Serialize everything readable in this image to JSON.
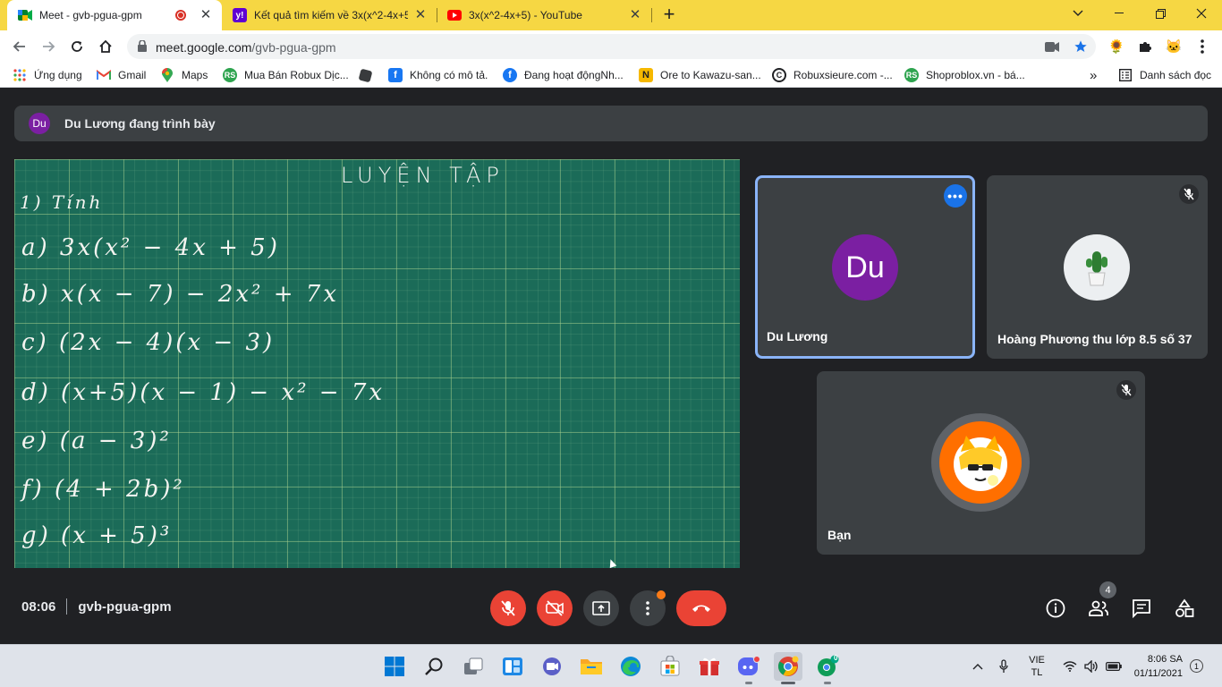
{
  "browser": {
    "tabs": [
      {
        "title": "Meet - gvb-pgua-gpm",
        "active": true
      },
      {
        "title": "Kết quả tìm kiếm về 3x(x^2-4x+5",
        "active": false
      },
      {
        "title": "3x(x^2-4x+5) - YouTube",
        "active": false
      }
    ],
    "url_host": "meet.google.com",
    "url_path": "/gvb-pgua-gpm",
    "bookmarks": [
      {
        "label": "Ứng dụng",
        "icon": "apps-grid-icon"
      },
      {
        "label": "Gmail",
        "icon": "gmail-icon"
      },
      {
        "label": "Maps",
        "icon": "maps-icon"
      },
      {
        "label": "Mua Bán Robux Dịc...",
        "icon": "rs-icon"
      },
      {
        "label": "",
        "icon": "roblox-icon"
      },
      {
        "label": "Không có mô tả.",
        "icon": "facebook-icon"
      },
      {
        "label": "Đang hoạt độngNh...",
        "icon": "facebook-round-icon"
      },
      {
        "label": "Ore to Kawazu-san...",
        "icon": "n-icon"
      },
      {
        "label": "Robuxsieure.com -...",
        "icon": "c-icon"
      },
      {
        "label": "Shoproblox.vn - bá...",
        "icon": "rs-icon"
      }
    ],
    "more_bookmarks": "»",
    "reading_list": "Danh sách đọc"
  },
  "meet": {
    "presenter_initials": "Du",
    "presenter_text": "Du Lương đang trình bày",
    "board": {
      "title": "LUYỆN TẬP",
      "lines": [
        "1) Tính",
        "a)  3x(x² − 4x + 5)",
        "b)   x(x − 7) − 2x² + 7x",
        "c)   (2x − 4)(x − 3)",
        "d)   (x+5)(x − 1) − x² − 7x",
        "e)   (a − 3)²",
        "f)   (4 + 2b)²",
        "g)   (x + 5)³"
      ]
    },
    "participants": [
      {
        "name": "Du Lương",
        "initials": "Du",
        "color": "#7b1fa2",
        "speaking": true
      },
      {
        "name": "Hoàng Phương thu lớp 8.5 số 37",
        "initials": "",
        "muted": true
      },
      {
        "name": "Bạn",
        "initials": "",
        "muted": true
      }
    ],
    "time": "08:06",
    "meeting_code": "gvb-pgua-gpm",
    "people_count": "4"
  },
  "taskbar": {
    "language": "VIE",
    "layout": "TL",
    "time": "8:06 SA",
    "date": "01/11/2021",
    "notifications": "1",
    "whatsapp_badge": "0"
  }
}
